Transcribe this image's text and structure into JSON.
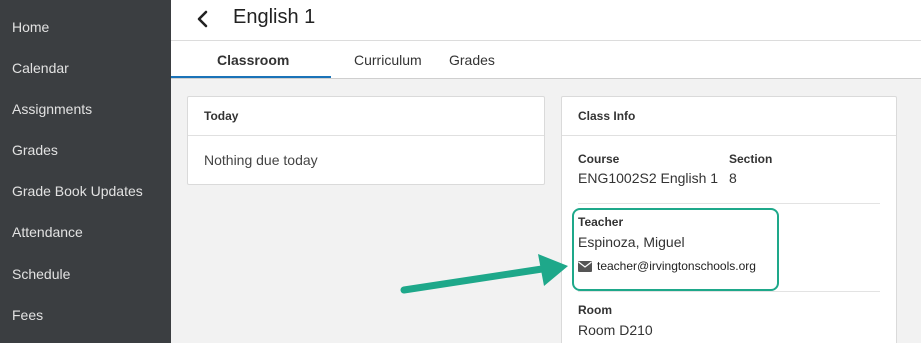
{
  "sidebar": {
    "items": [
      {
        "label": "Home"
      },
      {
        "label": "Calendar"
      },
      {
        "label": "Assignments"
      },
      {
        "label": "Grades"
      },
      {
        "label": "Grade Book Updates"
      },
      {
        "label": "Attendance"
      },
      {
        "label": "Schedule"
      },
      {
        "label": "Fees"
      }
    ]
  },
  "header": {
    "title": "English 1",
    "back_icon": "chevron-left-icon"
  },
  "tabs": [
    {
      "label": "Classroom",
      "active": true
    },
    {
      "label": "Curriculum",
      "active": false
    },
    {
      "label": "Grades",
      "active": false
    }
  ],
  "today_card": {
    "title": "Today",
    "message": "Nothing due today"
  },
  "class_info": {
    "title": "Class Info",
    "course_label": "Course",
    "course_value": "ENG1002S2 English 1",
    "section_label": "Section",
    "section_value": "8",
    "teacher_label": "Teacher",
    "teacher_name": "Espinoza, Miguel",
    "teacher_email": "teacher@irvingtonschools.org",
    "email_icon": "envelope-icon",
    "room_label": "Room",
    "room_value": "Room D210"
  },
  "colors": {
    "sidebar_bg": "#3b3e41",
    "tab_accent": "#1a73b8",
    "highlight": "#1ea88a"
  }
}
